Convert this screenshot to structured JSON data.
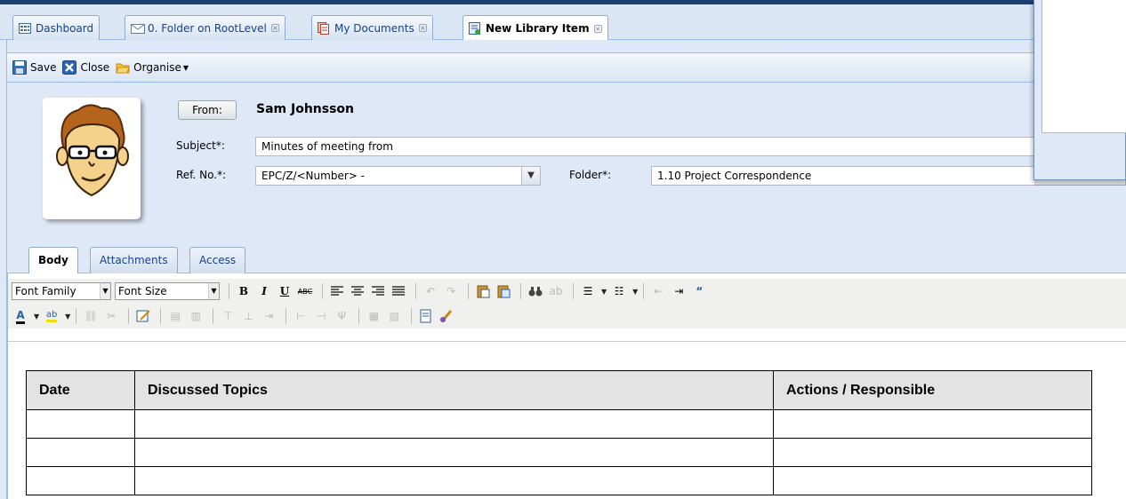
{
  "tabs": [
    {
      "label": "Dashboard",
      "icon": "dashboard-icon",
      "closable": false
    },
    {
      "label": "0. Folder on RootLevel",
      "icon": "envelope-icon",
      "closable": true
    },
    {
      "label": "My Documents",
      "icon": "documents-icon",
      "closable": true
    },
    {
      "label": "New Library Item",
      "icon": "new-library-item-icon",
      "closable": true,
      "active": true
    }
  ],
  "toolbar": {
    "save_label": "Save",
    "close_label": "Close",
    "organise_label": "Organise"
  },
  "form": {
    "from_button": "From:",
    "from_name": "Sam Johnsson",
    "subject_label": "Subject*:",
    "subject_value": "Minutes of meeting from",
    "refno_label": "Ref. No.*:",
    "refno_value": "EPC/Z/<Number> -",
    "folder_label": "Folder*:",
    "folder_value": "1.10 Project Correspondence"
  },
  "subtabs": [
    "Body",
    "Attachments",
    "Access"
  ],
  "editor": {
    "font_family": "Font Family",
    "font_size": "Font Size"
  },
  "table": {
    "headers": [
      "Date",
      "Discussed Topics",
      "Actions / Responsible"
    ],
    "rows": [
      [
        "",
        "",
        ""
      ],
      [
        "",
        "",
        ""
      ],
      [
        "",
        "",
        ""
      ]
    ]
  },
  "colors": {
    "accent": "#15428b",
    "panel_bg": "#dfe8f6",
    "border": "#99bbe8",
    "header_cell_bg": "#e3e3e3"
  }
}
